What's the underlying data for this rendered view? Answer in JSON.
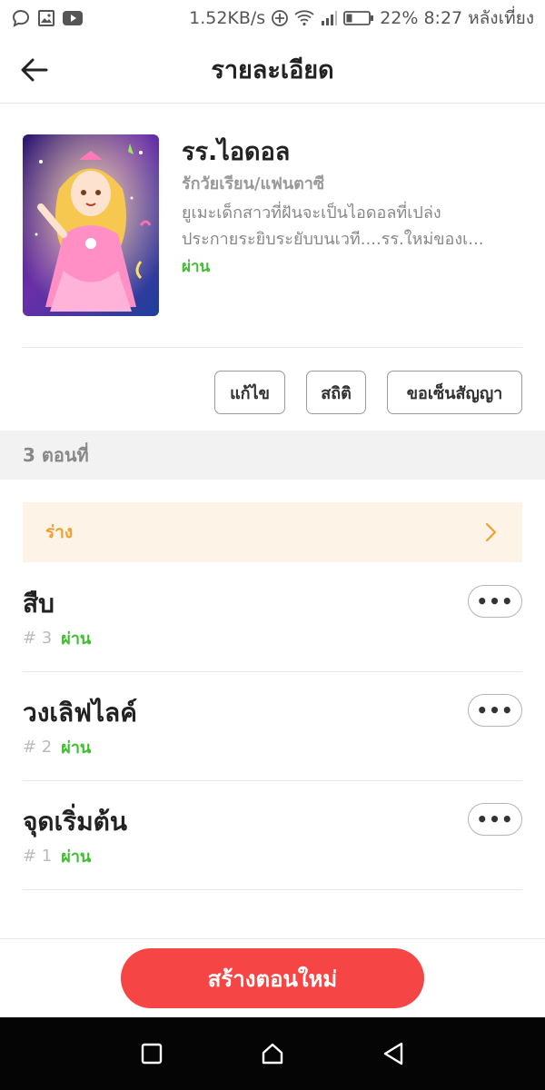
{
  "status_bar": {
    "speed": "1.52KB/s",
    "battery": "22%",
    "time": "8:27",
    "period": "หลังเที่ยง",
    "icons": [
      "chat-bubble-icon",
      "image-icon",
      "youtube-icon",
      "data-saver-icon",
      "wifi-icon",
      "signal-icon",
      "battery-icon"
    ]
  },
  "header": {
    "title": "รายละเอียด",
    "back_icon": "arrow-left-icon"
  },
  "story": {
    "title": "รร.ไอดอล",
    "genre": "รักวัยเรียน/แฟนตาซี",
    "description_line1": "ยูเมะเด็กสาวที่ฝันจะเป็นไอดอลที่เปล่ง",
    "description_line2": "ประกายระยิบระยับบนเวที....รร.ใหม่ของเ...",
    "status": "ผ่าน"
  },
  "actions": {
    "edit": "แก้ไข",
    "stats": "สถิติ",
    "contract": "ขอเซ็นสัญญา"
  },
  "episodes_header": "3 ตอนที่",
  "draft": {
    "label": "ร่าง"
  },
  "episodes": [
    {
      "title": "สืบ",
      "number": "# 3",
      "status": "ผ่าน",
      "more": "•••"
    },
    {
      "title": "วงเลิฟไลค์",
      "number": "# 2",
      "status": "ผ่าน",
      "more": "•••"
    },
    {
      "title": "จุดเริ่มต้น",
      "number": "# 1",
      "status": "ผ่าน",
      "more": "•••"
    }
  ],
  "create_button": "สร้างตอนใหม่",
  "colors": {
    "accent_red": "#f54545",
    "status_green": "#3fbf2f",
    "draft_orange": "#f0a030",
    "draft_bg": "#fdf3e6"
  }
}
